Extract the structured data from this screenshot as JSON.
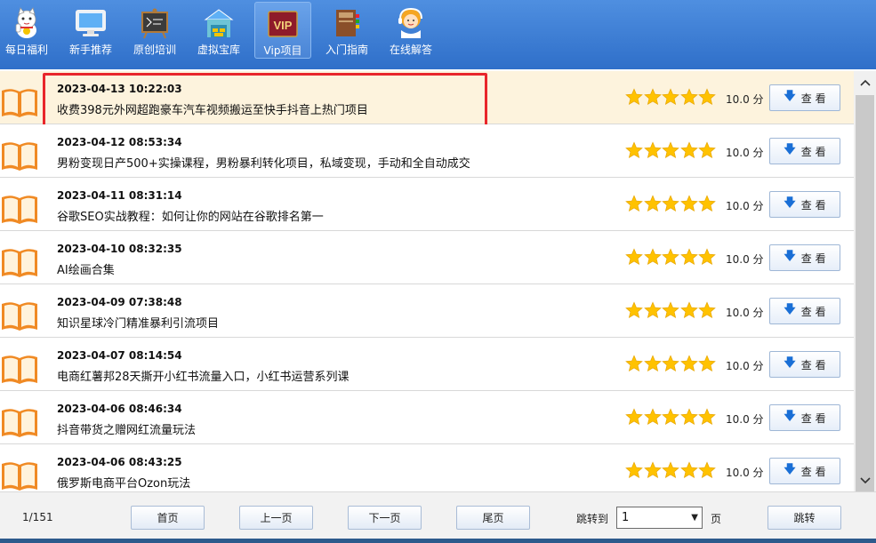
{
  "toolbar": {
    "items": [
      {
        "label": "每日福利",
        "icon": "lucky-cat-icon"
      },
      {
        "label": "新手推荐",
        "icon": "monitor-icon"
      },
      {
        "label": "原创培训",
        "icon": "blackboard-icon"
      },
      {
        "label": "虚拟宝库",
        "icon": "treasure-house-icon"
      },
      {
        "label": "Vip项目",
        "icon": "vip-icon",
        "active": true,
        "badge": "VIP"
      },
      {
        "label": "入门指南",
        "icon": "guide-book-icon"
      },
      {
        "label": "在线解答",
        "icon": "support-agent-icon"
      }
    ]
  },
  "list": {
    "items": [
      {
        "date": "2023-04-13 10:22:03",
        "title": "收费398元外网超跑豪车汽车视频搬运至快手抖音上热门项目",
        "rating": 5,
        "score": "10.0 分",
        "button": "查 看",
        "highlighted": true
      },
      {
        "date": "2023-04-12 08:53:34",
        "title": "男粉变现日产500+实操课程，男粉暴利转化项目，私域变现，手动和全自动成交",
        "rating": 5,
        "score": "10.0 分",
        "button": "查 看"
      },
      {
        "date": "2023-04-11 08:31:14",
        "title": "谷歌SEO实战教程：如何让你的网站在谷歌排名第一",
        "rating": 5,
        "score": "10.0 分",
        "button": "查 看"
      },
      {
        "date": "2023-04-10 08:32:35",
        "title": "AI绘画合集",
        "rating": 5,
        "score": "10.0 分",
        "button": "查 看"
      },
      {
        "date": "2023-04-09 07:38:48",
        "title": "知识星球冷门精准暴利引流项目",
        "rating": 5,
        "score": "10.0 分",
        "button": "查 看"
      },
      {
        "date": "2023-04-07 08:14:54",
        "title": "电商红薯邦28天撕开小红书流量入口，小红书运营系列课",
        "rating": 5,
        "score": "10.0 分",
        "button": "查 看"
      },
      {
        "date": "2023-04-06 08:46:34",
        "title": "抖音带货之赠网红流量玩法",
        "rating": 5,
        "score": "10.0 分",
        "button": "查 看"
      },
      {
        "date": "2023-04-06 08:43:25",
        "title": "俄罗斯电商平台Ozon玩法",
        "rating": 5,
        "score": "10.0 分",
        "button": "查 看"
      }
    ]
  },
  "pager": {
    "count": "1/151",
    "first": "首页",
    "prev": "上一页",
    "next": "下一页",
    "last": "尾页",
    "jump_label": "跳转到",
    "page_value": "1",
    "page_unit": "页",
    "jump_button": "跳转"
  },
  "colors": {
    "toolbar_blue": "#3a7bd5",
    "star_yellow": "#ffc200",
    "highlight_row": "#fdf3dd",
    "selection_red": "#e8262b",
    "book_orange": "#f08a24"
  }
}
